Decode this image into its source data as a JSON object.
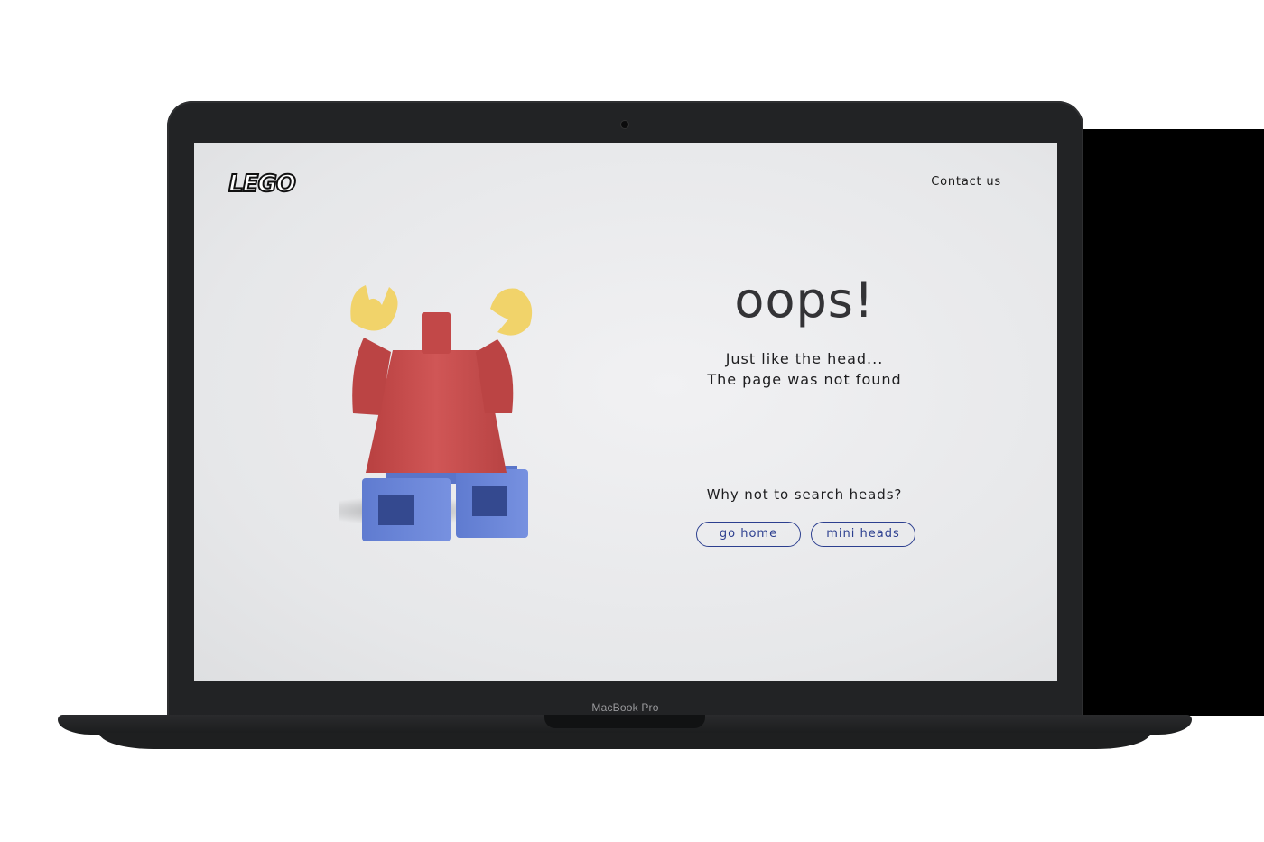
{
  "device": {
    "model_label": "MacBook Pro"
  },
  "header": {
    "logo_text": "LEGO",
    "contact_label": "Contact us"
  },
  "error": {
    "title": "oops!",
    "line1": "Just like the head...",
    "line2": "The page was not found",
    "prompt": "Why not to search heads?"
  },
  "actions": {
    "go_home_label": "go home",
    "mini_heads_label": "mini heads"
  },
  "colors": {
    "button_accent": "#2c3f8f",
    "torso": "#c94b4b",
    "legs": "#6a86d8",
    "hands": "#f1d36a"
  }
}
